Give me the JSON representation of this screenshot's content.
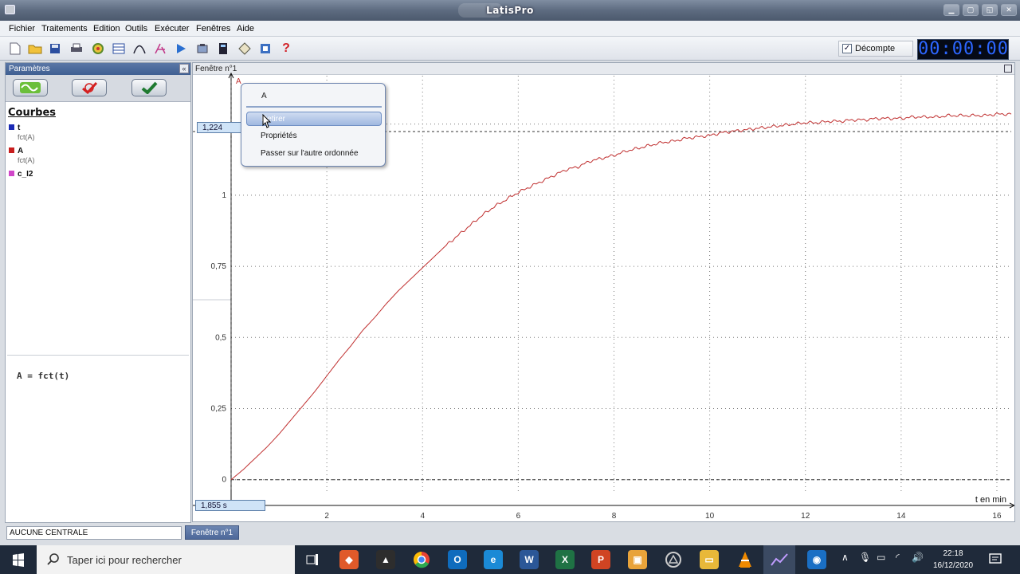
{
  "window": {
    "title": "LatisPro"
  },
  "menu": [
    "Fichier",
    "Traitements",
    "Edition",
    "Outils",
    "Exécuter",
    "Fenêtres",
    "Aide"
  ],
  "toolbar": {
    "icons": [
      "new-file-icon",
      "open-folder-icon",
      "save-icon",
      "print-icon",
      "settings-wheel-icon",
      "table-icon",
      "curve-model-icon",
      "tangent-icon",
      "play-icon",
      "acquisition-icon",
      "calculator-icon",
      "tools-icon",
      "help-icon"
    ],
    "decompte_label": "Décompte",
    "decompte_checked": true,
    "timer": "00:00:00"
  },
  "params": {
    "header": "Paramètres",
    "courbes_title": "Courbes",
    "curves": [
      {
        "name": "t",
        "sub": "fct(A)",
        "color": "#1b2bb5"
      },
      {
        "name": "A",
        "sub": "fct(A)",
        "color": "#c81e1e"
      },
      {
        "name": "c_I2",
        "sub": "",
        "color": "#d046c8"
      }
    ],
    "formula": "A = fct(t)"
  },
  "graph": {
    "window_title": "Fenêtre n°1",
    "y_axis_letter": "A",
    "cursor_y_value": "1,224",
    "cursor_x_value": "1,855 s",
    "x_label": "t en min"
  },
  "chart_data": {
    "type": "line",
    "xlabel": "t en min",
    "ylabel": "A",
    "xlim": [
      0,
      16.3
    ],
    "ylim": [
      -0.04,
      1.42
    ],
    "x_ticks": [
      "2",
      "4",
      "6",
      "8",
      "10",
      "12",
      "14",
      "16"
    ],
    "y_ticks": [
      "0",
      "0,25",
      "0,5",
      "0,75",
      "1"
    ],
    "series": [
      {
        "name": "A",
        "color": "#c03030",
        "x": [
          0,
          0.25,
          0.5,
          0.75,
          1,
          1.25,
          1.5,
          1.75,
          2,
          2.25,
          2.5,
          2.75,
          3,
          3.25,
          3.5,
          3.75,
          4,
          4.25,
          4.5,
          4.75,
          5,
          5.25,
          5.5,
          5.75,
          6,
          6.25,
          6.5,
          6.75,
          7,
          7.25,
          7.5,
          7.75,
          8,
          8.25,
          8.5,
          8.75,
          9,
          9.25,
          9.5,
          9.75,
          10,
          10.25,
          10.5,
          10.75,
          11,
          11.25,
          11.5,
          11.75,
          12,
          12.25,
          12.5,
          12.75,
          13,
          13.25,
          13.5,
          13.75,
          14,
          14.25,
          14.5,
          14.75,
          15,
          15.25,
          15.5,
          15.75,
          16,
          16.3
        ],
        "y": [
          0,
          0.035,
          0.075,
          0.115,
          0.16,
          0.21,
          0.26,
          0.31,
          0.365,
          0.42,
          0.47,
          0.525,
          0.57,
          0.62,
          0.665,
          0.705,
          0.745,
          0.785,
          0.825,
          0.86,
          0.895,
          0.93,
          0.96,
          0.985,
          1.01,
          1.03,
          1.05,
          1.07,
          1.09,
          1.1,
          1.12,
          1.13,
          1.14,
          1.155,
          1.165,
          1.175,
          1.185,
          1.19,
          1.2,
          1.205,
          1.21,
          1.22,
          1.225,
          1.23,
          1.235,
          1.24,
          1.245,
          1.25,
          1.255,
          1.255,
          1.26,
          1.26,
          1.265,
          1.265,
          1.27,
          1.27,
          1.27,
          1.275,
          1.275,
          1.275,
          1.28,
          1.28,
          1.28,
          1.28,
          1.285,
          1.285
        ]
      }
    ],
    "cursor": {
      "x": 0,
      "y": 1.224
    },
    "grid": true
  },
  "context_menu": {
    "header": "A",
    "items": [
      "Retirer",
      "Propriétés",
      "Passer sur l'autre ordonnée"
    ],
    "highlighted": "Retirer"
  },
  "status": {
    "central": "AUCUNE CENTRALE",
    "tab": "Fenêtre n°1"
  },
  "taskbar": {
    "search_placeholder": "Taper ici pour rechercher",
    "time": "22:18",
    "date": "16/12/2020",
    "apps": [
      "task-view-icon",
      "paint-app-icon",
      "inkscape-icon",
      "chrome-icon",
      "outlook-icon",
      "edge-icon",
      "word-icon",
      "excel-icon",
      "powerpoint-icon",
      "box-app-icon",
      "app-icon",
      "file-explorer-icon",
      "vlc-icon",
      "latispro-icon",
      "camera-app-icon"
    ]
  }
}
